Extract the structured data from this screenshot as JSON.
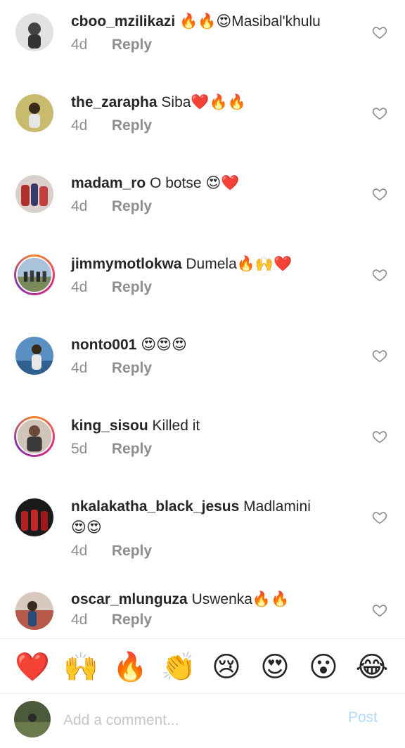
{
  "comments": [
    {
      "username": "cboo_mzilikazi",
      "text": "🔥🔥😍Masibal'khulu",
      "time": "4d",
      "reply": "Reply",
      "avatar_color": "#d7d7d7",
      "story_ring": false,
      "heart_icon": "heart-outline-icon"
    },
    {
      "username": "the_zarapha",
      "text": "Siba❤️🔥🔥",
      "time": "4d",
      "reply": "Reply",
      "avatar_color": "#c8b86a",
      "story_ring": false,
      "heart_icon": "heart-outline-icon"
    },
    {
      "username": "madam_ro",
      "text": "O botse 😍❤️",
      "time": "4d",
      "reply": "Reply",
      "avatar_color": "#b24a4a",
      "story_ring": false,
      "heart_icon": "heart-outline-icon"
    },
    {
      "username": "jimmymotlokwa",
      "text": "Dumela🔥🙌❤️",
      "time": "4d",
      "reply": "Reply",
      "avatar_color": "#8aa7c2",
      "story_ring": true,
      "heart_icon": "heart-outline-icon"
    },
    {
      "username": "nonto001",
      "text": "😍😍😍",
      "time": "4d",
      "reply": "Reply",
      "avatar_color": "#4f84b8",
      "story_ring": false,
      "heart_icon": "heart-outline-icon"
    },
    {
      "username": "king_sisou",
      "text": "Killed it",
      "time": "5d",
      "reply": "Reply",
      "avatar_color": "#6a4b3a",
      "story_ring": true,
      "heart_icon": "heart-outline-icon"
    },
    {
      "username": "nkalakatha_black_jesus",
      "text": "Madlamini",
      "text2": "😍😍",
      "time": "4d",
      "reply": "Reply",
      "avatar_color": "#7a1a1a",
      "story_ring": false,
      "heart_icon": "heart-outline-icon"
    },
    {
      "username": "oscar_mlunguza",
      "text": "Uswenka🔥🔥",
      "time": "4d",
      "reply": "Reply",
      "avatar_color": "#b55a4a",
      "story_ring": false,
      "heart_icon": "heart-outline-icon"
    }
  ],
  "reactions": [
    "❤️",
    "🙌",
    "🔥",
    "👏",
    "😢",
    "😍",
    "😮",
    "😂"
  ],
  "composer": {
    "placeholder": "Add a comment...",
    "post_label": "Post",
    "avatar_color": "#4a5a3a"
  }
}
